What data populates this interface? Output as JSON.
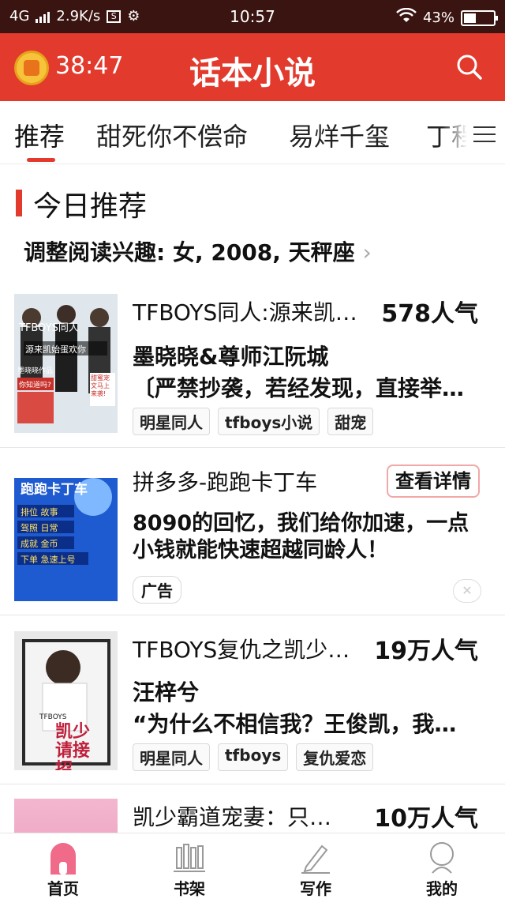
{
  "status_bar": {
    "network": "4G",
    "speed": "2.9K/s",
    "s_badge": "S",
    "time": "10:57",
    "battery": "43%",
    "battery_level": 0.43
  },
  "header": {
    "timer": "38:47",
    "title": "话本小说",
    "search_icon": "search-icon",
    "timer_icon": "alarm-coin-icon"
  },
  "tabs": [
    {
      "label": "推荐"
    },
    {
      "label": "甜死你不偿命"
    },
    {
      "label": "易烊千玺"
    },
    {
      "label": "丁程"
    }
  ],
  "section": {
    "title": "今日推荐",
    "interest": "调整阅读兴趣: 女, 2008, 天秤座",
    "interest_chevron": "›"
  },
  "items": [
    {
      "title": "TFBOYS同人:源来凯…",
      "popularity": "578人气",
      "author": "墨晓晓&尊师江阮城",
      "desc": "〔严禁抄袭，若经发现，直接举…",
      "tags": [
        "明星同人",
        "tfboys小说",
        "甜宠"
      ],
      "cover": {
        "top": "TFBOYS同人",
        "mid": "源来凯始蛋欢你",
        "left": "墨晓晓作品",
        "badge": "你知道吗?",
        "right": "甜蜜宠文马上来袭!"
      }
    },
    {
      "title": "拼多多-跑跑卡丁车",
      "detail_button": "查看详情",
      "ad_text": "8090的回忆，我们给你加速，一点小钱就能快速超越同龄人！",
      "ad_tag": "广告",
      "close": "✕",
      "cover": {
        "top": "跑跑卡丁车",
        "lines": [
          "排位 故事",
          "驾照 日常",
          "成就 金币",
          "下单 急速上号"
        ]
      }
    },
    {
      "title": "TFBOYS复仇之凯少…",
      "popularity": "19万人气",
      "author": "汪梓兮",
      "desc": "“为什么不相信我？王俊凯，我…",
      "tags": [
        "明星同人",
        "tfboys",
        "复仇爱恋"
      ],
      "cover": {
        "top": "TFBOYS",
        "title": "凯少请接招"
      }
    },
    {
      "title": "凯少霸道宠妻：只…",
      "popularity": "10万人气"
    }
  ],
  "bottom_nav": [
    {
      "label": "首页",
      "icon": "home-icon"
    },
    {
      "label": "书架",
      "icon": "bookshelf-icon"
    },
    {
      "label": "写作",
      "icon": "pen-icon"
    },
    {
      "label": "我的",
      "icon": "profile-icon"
    }
  ],
  "colors": {
    "accent": "#e23a2d",
    "statusbar": "#3a1410",
    "home_active": "#f06a8a"
  }
}
